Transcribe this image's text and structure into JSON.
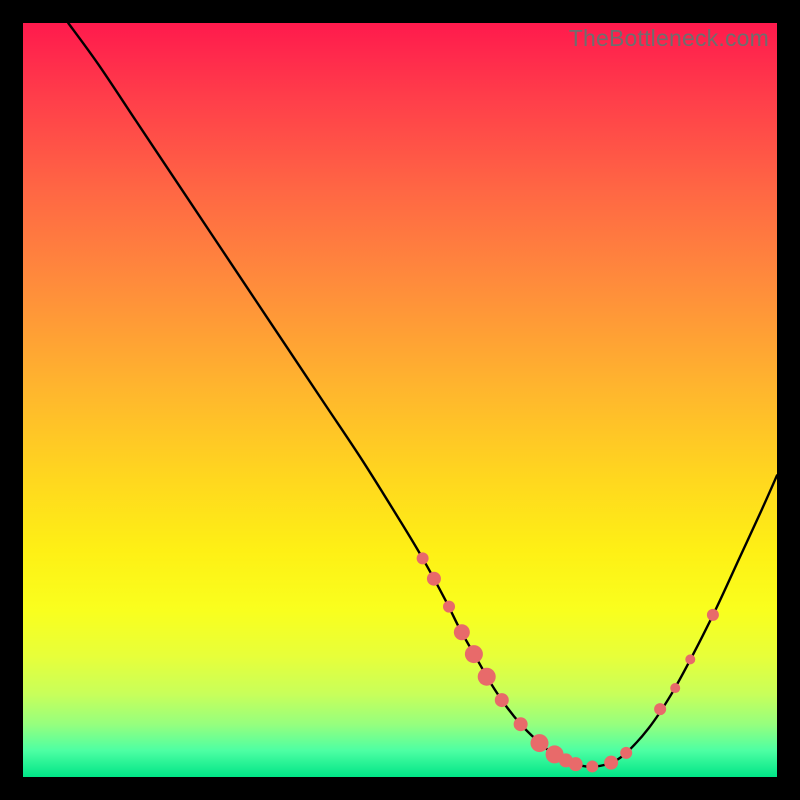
{
  "watermark": "TheBottleneck.com",
  "colors": {
    "background": "#000000",
    "curve": "#000000",
    "marker_fill": "#e86a6a",
    "marker_stroke": "#c94f4f"
  },
  "chart_data": {
    "type": "line",
    "title": "",
    "xlabel": "",
    "ylabel": "",
    "xlim": [
      0,
      100
    ],
    "ylim": [
      0,
      100
    ],
    "series": [
      {
        "name": "bottleneck-curve",
        "x": [
          6,
          10,
          15,
          20,
          25,
          30,
          35,
          40,
          45,
          50,
          53,
          56,
          58,
          60,
          62,
          64,
          66,
          68,
          70,
          72,
          74,
          76,
          78,
          80,
          83,
          86,
          89,
          92,
          95,
          98,
          100
        ],
        "y": [
          100,
          94.5,
          87,
          79.5,
          72,
          64.5,
          57,
          49.5,
          42,
          34,
          29,
          23.5,
          19.5,
          16,
          12.5,
          9.5,
          7,
          5,
          3.3,
          2.2,
          1.5,
          1.4,
          1.9,
          3.2,
          6.5,
          11,
          16.5,
          22.5,
          29,
          35.5,
          40
        ]
      }
    ],
    "markers": [
      {
        "x": 53.0,
        "y": 29.0,
        "r": 6
      },
      {
        "x": 54.5,
        "y": 26.3,
        "r": 7
      },
      {
        "x": 56.5,
        "y": 22.6,
        "r": 6
      },
      {
        "x": 58.2,
        "y": 19.2,
        "r": 8
      },
      {
        "x": 59.8,
        "y": 16.3,
        "r": 9
      },
      {
        "x": 61.5,
        "y": 13.3,
        "r": 9
      },
      {
        "x": 63.5,
        "y": 10.2,
        "r": 7
      },
      {
        "x": 66.0,
        "y": 7.0,
        "r": 7
      },
      {
        "x": 68.5,
        "y": 4.5,
        "r": 9
      },
      {
        "x": 70.5,
        "y": 3.0,
        "r": 9
      },
      {
        "x": 72.0,
        "y": 2.2,
        "r": 7
      },
      {
        "x": 73.3,
        "y": 1.7,
        "r": 7
      },
      {
        "x": 75.5,
        "y": 1.4,
        "r": 6
      },
      {
        "x": 78.0,
        "y": 1.9,
        "r": 7
      },
      {
        "x": 80.0,
        "y": 3.2,
        "r": 6
      },
      {
        "x": 84.5,
        "y": 9.0,
        "r": 6
      },
      {
        "x": 86.5,
        "y": 11.8,
        "r": 5
      },
      {
        "x": 88.5,
        "y": 15.6,
        "r": 5
      },
      {
        "x": 91.5,
        "y": 21.5,
        "r": 6
      }
    ],
    "annotations": []
  }
}
